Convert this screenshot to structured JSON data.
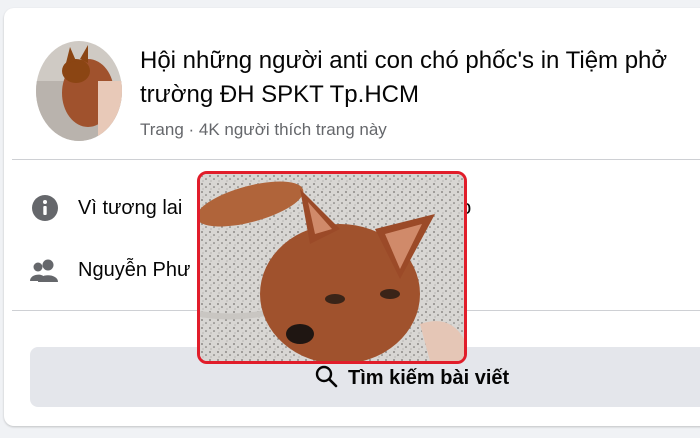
{
  "page": {
    "title": "Hội những người anti con chó phốc's in Tiệm phở trường ĐH SPKT Tp.HCM",
    "title_line1": "Hội những người anti con chó phốc's in Tiệm phở",
    "title_line2": "trường ĐH SPKT Tp.HCM",
    "subtitle": "Trang · 4K người thích trang này"
  },
  "info_rows": [
    {
      "icon": "info-icon",
      "text": "Vì tương lai                                             hoto"
    },
    {
      "icon": "people-icon",
      "text": "Nguyễn Phư"
    }
  ],
  "search": {
    "label": "Tìm kiếm bài viết",
    "icon": "search-icon"
  },
  "overlay": {
    "description_icon": "dog-photo"
  },
  "colors": {
    "highlight": "#e11d2a",
    "card": "#ffffff",
    "background": "#f0f2f5",
    "secondary_text": "#65676b"
  }
}
